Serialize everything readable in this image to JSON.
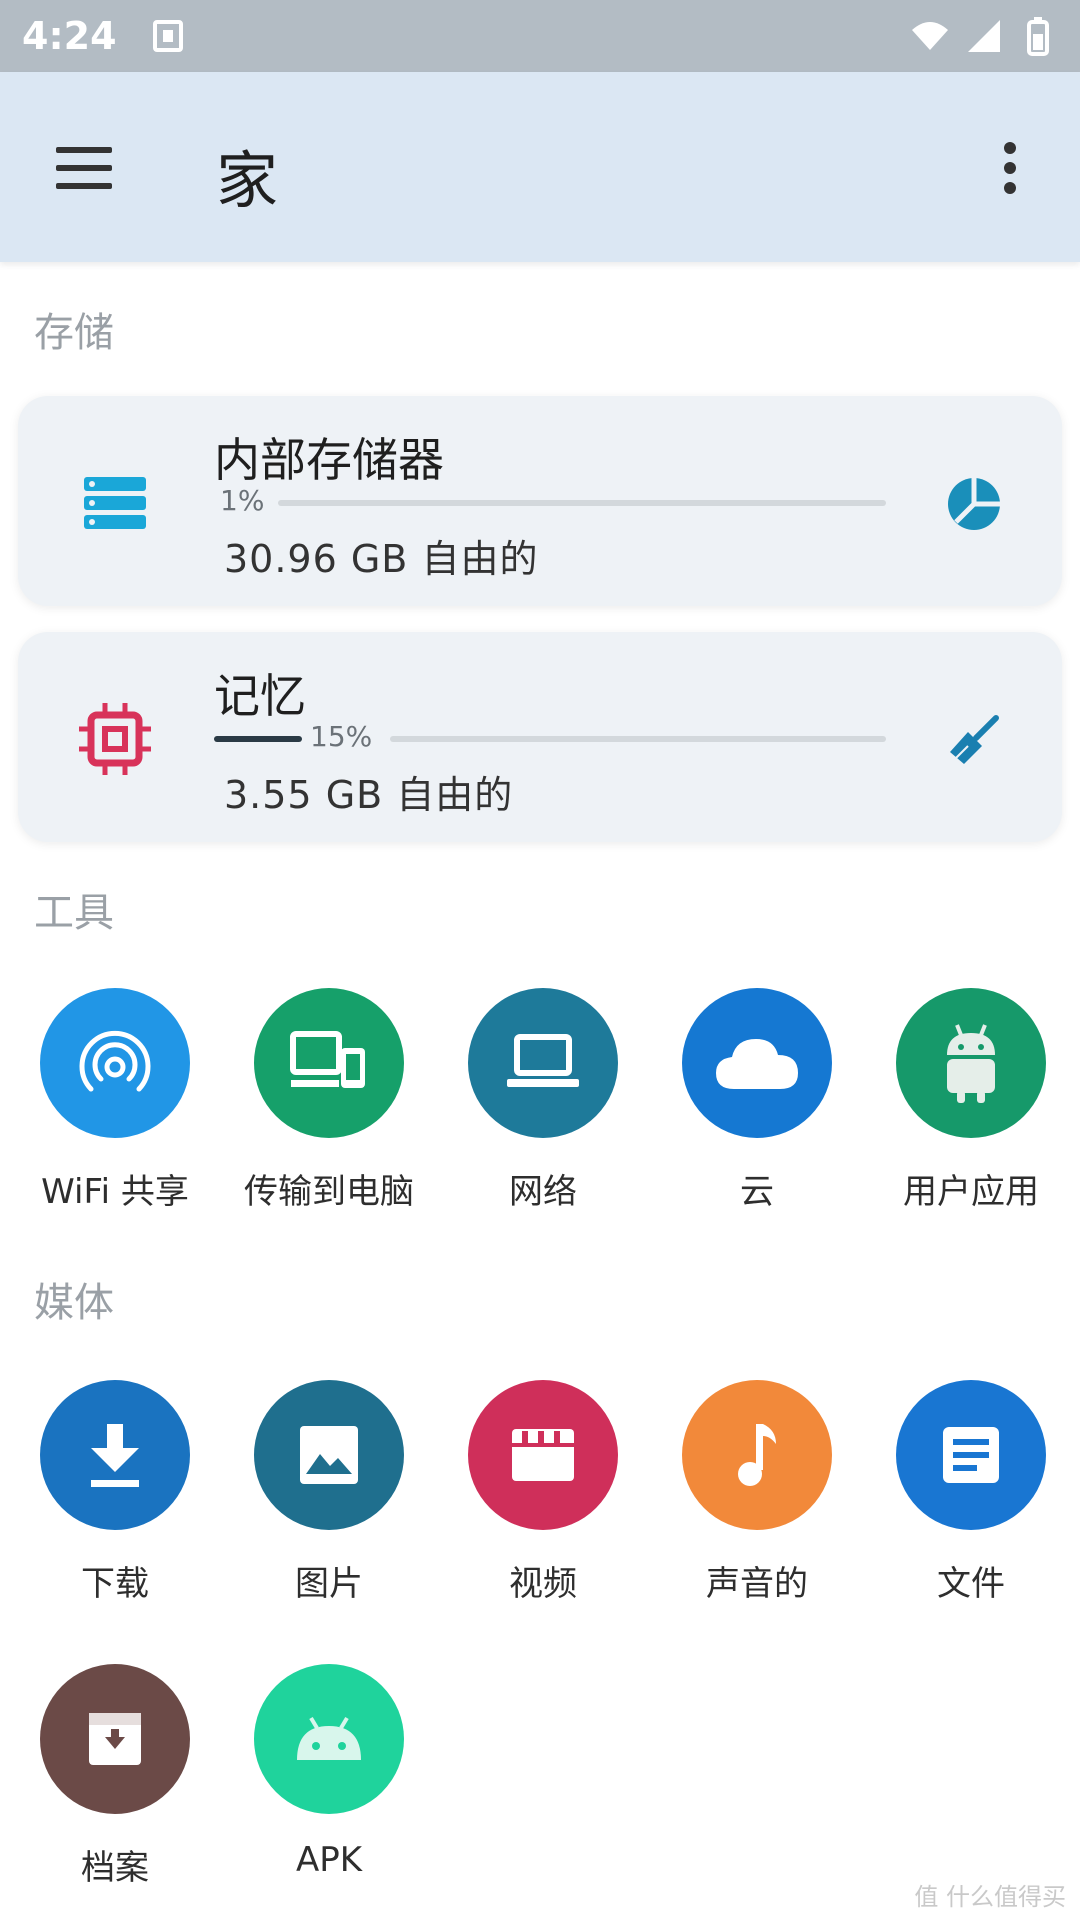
{
  "status_bar": {
    "time": "4:24"
  },
  "app_bar": {
    "title": "家"
  },
  "sections": {
    "storage": "存储",
    "tools": "工具",
    "media": "媒体"
  },
  "storage_cards": [
    {
      "name": "内部存储器",
      "percent_label": "1%",
      "percent": 1,
      "free": "30.96 GB 自由的",
      "accent": "#1aa7d8"
    },
    {
      "name": "记忆",
      "percent_label": "15%",
      "percent": 15,
      "free": "3.55 GB 自由的",
      "accent": "#d8335a"
    }
  ],
  "tools": [
    {
      "label": "WiFi 共享",
      "color": "#2196e6",
      "icon": "wifi-share-icon"
    },
    {
      "label": "传输到电脑",
      "color": "#16a06a",
      "icon": "devices-icon"
    },
    {
      "label": "网络",
      "color": "#1e7a9a",
      "icon": "laptop-icon"
    },
    {
      "label": "云",
      "color": "#1578d2",
      "icon": "cloud-icon"
    },
    {
      "label": "用户应用",
      "color": "#16996a",
      "icon": "android-icon"
    }
  ],
  "media": [
    {
      "label": "下载",
      "color": "#1a73c0",
      "icon": "download-icon"
    },
    {
      "label": "图片",
      "color": "#1f6f8e",
      "icon": "image-icon"
    },
    {
      "label": "视频",
      "color": "#cf2f5a",
      "icon": "video-icon"
    },
    {
      "label": "声音的",
      "color": "#f2893a",
      "icon": "music-icon"
    },
    {
      "label": "文件",
      "color": "#1976d2",
      "icon": "document-icon"
    },
    {
      "label": "档案",
      "color": "#6b4a47",
      "icon": "archive-icon"
    },
    {
      "label": "APK",
      "color": "#1fd39c",
      "icon": "android-apk-icon"
    }
  ],
  "watermark": "值 什么值得买"
}
